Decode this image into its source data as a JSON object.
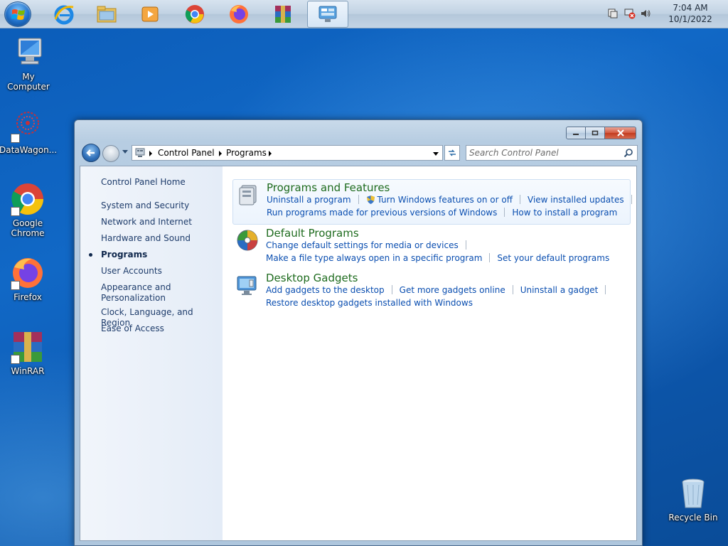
{
  "taskbar": {
    "items": [
      {
        "name": "internet-explorer"
      },
      {
        "name": "file-explorer"
      },
      {
        "name": "media-player"
      },
      {
        "name": "google-chrome"
      },
      {
        "name": "firefox"
      },
      {
        "name": "winrar"
      },
      {
        "name": "control-panel",
        "active": true
      }
    ],
    "clock_time": "7:04 AM",
    "clock_date": "10/1/2022"
  },
  "desktop": {
    "icons": [
      {
        "label": "My Computer"
      },
      {
        "label": "DataWagon..."
      },
      {
        "label": "Google Chrome"
      },
      {
        "label": "Firefox"
      },
      {
        "label": "WinRAR"
      },
      {
        "label": "Recycle Bin"
      }
    ]
  },
  "window": {
    "breadcrumbs": [
      "Control Panel",
      "Programs"
    ],
    "search_placeholder": "Search Control Panel",
    "sidebar": {
      "items": [
        {
          "label": "Control Panel Home"
        },
        {
          "label": "System and Security"
        },
        {
          "label": "Network and Internet"
        },
        {
          "label": "Hardware and Sound"
        },
        {
          "label": "Programs",
          "active": true
        },
        {
          "label": "User Accounts"
        },
        {
          "label": "Appearance and Personalization"
        },
        {
          "label": "Clock, Language, and Region"
        },
        {
          "label": "Ease of Access"
        }
      ]
    },
    "categories": [
      {
        "title": "Programs and Features",
        "links_row1": [
          "Uninstall a program",
          "Turn Windows features on or off",
          "View installed updates"
        ],
        "links_row2": [
          "Run programs made for previous versions of Windows",
          "How to install a program"
        ]
      },
      {
        "title": "Default Programs",
        "links_row1": [
          "Change default settings for media or devices"
        ],
        "links_row2": [
          "Make a file type always open in a specific program",
          "Set your default programs"
        ]
      },
      {
        "title": "Desktop Gadgets",
        "links_row1": [
          "Add gadgets to the desktop",
          "Get more gadgets online",
          "Uninstall a gadget"
        ],
        "links_row2": [
          "Restore desktop gadgets installed with Windows"
        ]
      }
    ]
  },
  "colors": {
    "link": "#0a4eb0",
    "category_title": "#1e6b1e",
    "sidebar_text": "#1e3c6b"
  }
}
